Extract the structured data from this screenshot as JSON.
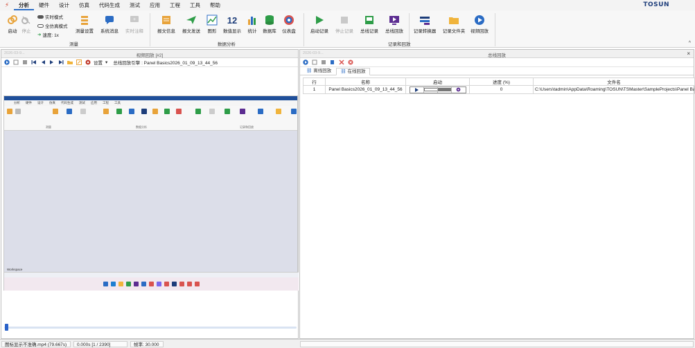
{
  "menu": {
    "items": [
      "分析",
      "硬件",
      "设计",
      "仿真",
      "代码生成",
      "测试",
      "应用",
      "工程",
      "工具",
      "帮助"
    ],
    "active": "分析",
    "brand": "TOSUN"
  },
  "ribbon": {
    "start": "启动",
    "stop": "停止",
    "realtime_mode": "实时模式",
    "full_sim_mode": "全仿真模式",
    "speed": "速度: 1x",
    "measure_setup": "测量设置",
    "system_messages": "系统消息",
    "realtime_comment": "实时注释",
    "group_measure": "测量",
    "msg_info": "报文信息",
    "msg_send": "报文发送",
    "graphics": "图形",
    "numeric_display": "数值显示",
    "numeric_icon": "12",
    "statistics": "统计",
    "database": "数据库",
    "dashboard": "仪表盘",
    "group_data_analysis": "数据分析",
    "start_record": "启动记录",
    "stop_record": "停止记录",
    "bus_record": "总线记录",
    "bus_playback": "总线回放",
    "record_converter": "记录转换器",
    "record_folder": "记录文件夹",
    "video_playback": "视频回放",
    "group_record_playback": "记录和回放",
    "colors": {
      "accent": "#2b6cc4",
      "green": "#2e9d48",
      "orange": "#e8a33a"
    }
  },
  "left_panel": {
    "faint_label": "2026-03-9...",
    "title": "视频回放 [#2]",
    "settings": "设置",
    "engine_label": "总线回放引擎 : Panel Basics2026_01_09_13_44_56",
    "video_tabs": "Workspace",
    "video_title_text": "TSMaster",
    "progress_fraction": 0.003
  },
  "right_panel": {
    "faint_label": "2026-03-9...",
    "title": "总线回放",
    "tabs": [
      "离线回放",
      "在线回放"
    ],
    "active_tab": "在线回放",
    "columns": [
      "行",
      "名称",
      "启动",
      "进度 (%)",
      "文件名"
    ],
    "rows": [
      {
        "row": "1",
        "name": "Panel Basics2026_01_09_13_44_56",
        "progress": "0",
        "filename": "C:\\Users\\tadmin\\AppData\\Roaming\\TOSUN\\TSMaster\\SampleProjects\\Panel Basi"
      }
    ]
  },
  "status": {
    "file": "图标显示不准确.mp4 (79.667s)",
    "time": "0.000s [1 / 2390]",
    "framerate": "帧率: 30.000"
  }
}
